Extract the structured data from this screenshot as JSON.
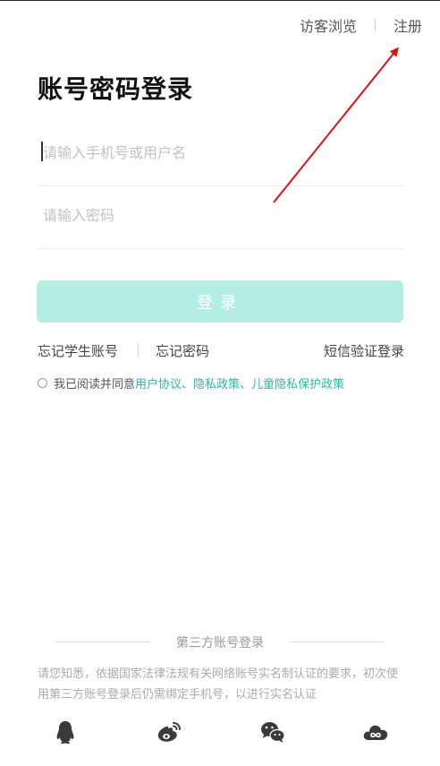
{
  "header": {
    "guest_browse_label": "访客浏览",
    "register_label": "注册"
  },
  "page_title": "账号密码登录",
  "form": {
    "username_placeholder": "请输入手机号或用户名",
    "password_placeholder": "请输入密码",
    "username_value": "",
    "password_value": "",
    "login_button_label": "登录",
    "login_button_color": "#b3ede4"
  },
  "links": {
    "forgot_student_account": "忘记学生账号",
    "forgot_password": "忘记密码",
    "sms_login": "短信验证登录"
  },
  "agreement": {
    "prefix": "我已阅读并同意",
    "user_agreement": "用户协议",
    "sep1": "、",
    "privacy_policy": "隐私政策",
    "sep2": "、",
    "child_privacy_policy": "儿童隐私保护政策",
    "checked": false,
    "link_color": "#27b8a6"
  },
  "third_party": {
    "title": "第三方账号登录",
    "notice": "请您知悉，依据国家法律法规有关网络账号实名制认证的要求，初次使用第三方账号登录后仍需绑定手机号，以进行实名认证",
    "providers": [
      {
        "icon": "qq-icon"
      },
      {
        "icon": "weibo-icon"
      },
      {
        "icon": "wechat-icon"
      },
      {
        "icon": "cloud-icon"
      }
    ]
  },
  "annotation": {
    "arrow_color": "#dd1111"
  }
}
